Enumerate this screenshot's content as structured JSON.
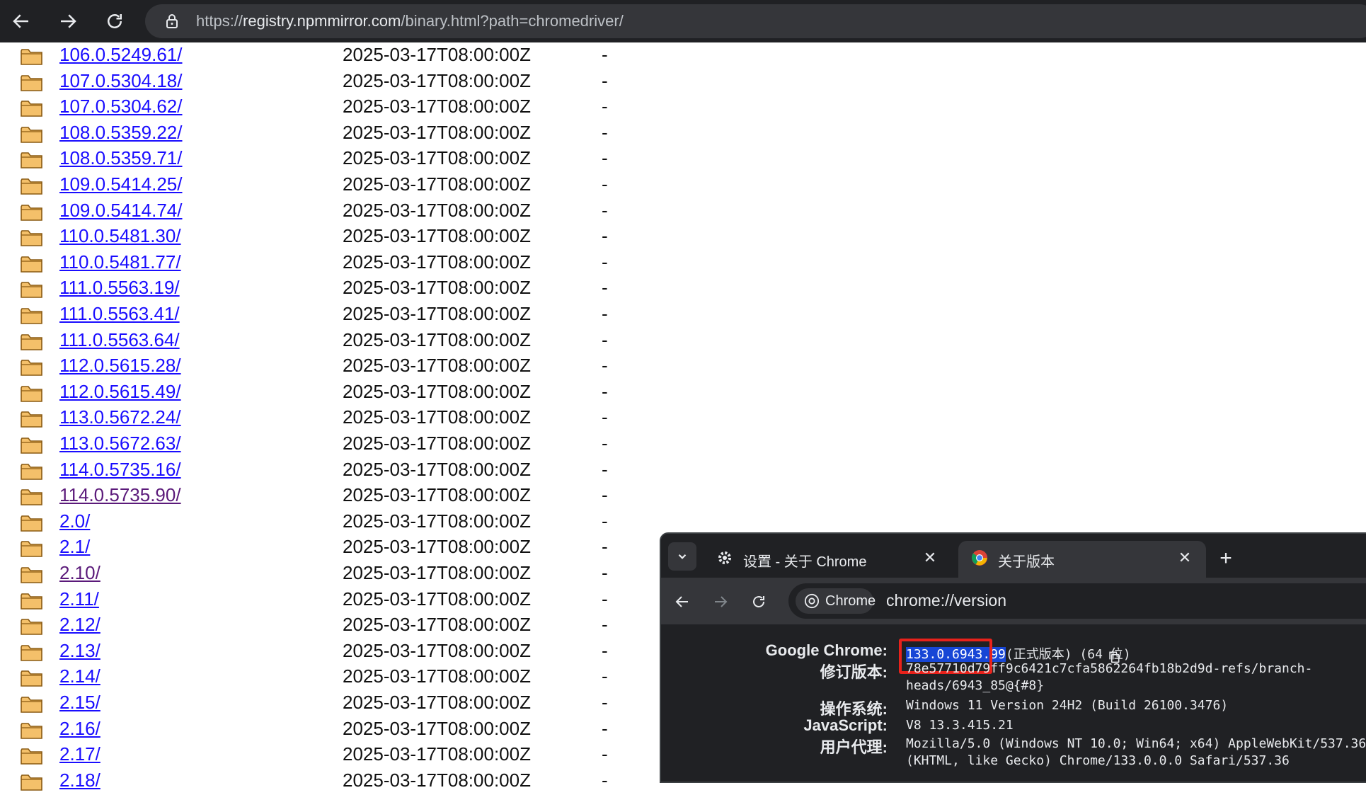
{
  "browser": {
    "url_scheme": "https://",
    "url_host": "registry.npmmirror.com",
    "url_path": "/binary.html?path=chromedriver/"
  },
  "listing": [
    {
      "name": "106.0.5249.61/",
      "date": "2025-03-17T08:00:00Z",
      "size": "-",
      "visited": false
    },
    {
      "name": "107.0.5304.18/",
      "date": "2025-03-17T08:00:00Z",
      "size": "-",
      "visited": false
    },
    {
      "name": "107.0.5304.62/",
      "date": "2025-03-17T08:00:00Z",
      "size": "-",
      "visited": false
    },
    {
      "name": "108.0.5359.22/",
      "date": "2025-03-17T08:00:00Z",
      "size": "-",
      "visited": false
    },
    {
      "name": "108.0.5359.71/",
      "date": "2025-03-17T08:00:00Z",
      "size": "-",
      "visited": false
    },
    {
      "name": "109.0.5414.25/",
      "date": "2025-03-17T08:00:00Z",
      "size": "-",
      "visited": false
    },
    {
      "name": "109.0.5414.74/",
      "date": "2025-03-17T08:00:00Z",
      "size": "-",
      "visited": false
    },
    {
      "name": "110.0.5481.30/",
      "date": "2025-03-17T08:00:00Z",
      "size": "-",
      "visited": false
    },
    {
      "name": "110.0.5481.77/",
      "date": "2025-03-17T08:00:00Z",
      "size": "-",
      "visited": false
    },
    {
      "name": "111.0.5563.19/",
      "date": "2025-03-17T08:00:00Z",
      "size": "-",
      "visited": false
    },
    {
      "name": "111.0.5563.41/",
      "date": "2025-03-17T08:00:00Z",
      "size": "-",
      "visited": false
    },
    {
      "name": "111.0.5563.64/",
      "date": "2025-03-17T08:00:00Z",
      "size": "-",
      "visited": false
    },
    {
      "name": "112.0.5615.28/",
      "date": "2025-03-17T08:00:00Z",
      "size": "-",
      "visited": false
    },
    {
      "name": "112.0.5615.49/",
      "date": "2025-03-17T08:00:00Z",
      "size": "-",
      "visited": false
    },
    {
      "name": "113.0.5672.24/",
      "date": "2025-03-17T08:00:00Z",
      "size": "-",
      "visited": false
    },
    {
      "name": "113.0.5672.63/",
      "date": "2025-03-17T08:00:00Z",
      "size": "-",
      "visited": false
    },
    {
      "name": "114.0.5735.16/",
      "date": "2025-03-17T08:00:00Z",
      "size": "-",
      "visited": false
    },
    {
      "name": "114.0.5735.90/",
      "date": "2025-03-17T08:00:00Z",
      "size": "-",
      "visited": true
    },
    {
      "name": "2.0/",
      "date": "2025-03-17T08:00:00Z",
      "size": "-",
      "visited": false
    },
    {
      "name": "2.1/",
      "date": "2025-03-17T08:00:00Z",
      "size": "-",
      "visited": false
    },
    {
      "name": "2.10/",
      "date": "2025-03-17T08:00:00Z",
      "size": "-",
      "visited": true
    },
    {
      "name": "2.11/",
      "date": "2025-03-17T08:00:00Z",
      "size": "-",
      "visited": false
    },
    {
      "name": "2.12/",
      "date": "2025-03-17T08:00:00Z",
      "size": "-",
      "visited": false
    },
    {
      "name": "2.13/",
      "date": "2025-03-17T08:00:00Z",
      "size": "-",
      "visited": false
    },
    {
      "name": "2.14/",
      "date": "2025-03-17T08:00:00Z",
      "size": "-",
      "visited": false
    },
    {
      "name": "2.15/",
      "date": "2025-03-17T08:00:00Z",
      "size": "-",
      "visited": false
    },
    {
      "name": "2.16/",
      "date": "2025-03-17T08:00:00Z",
      "size": "-",
      "visited": false
    },
    {
      "name": "2.17/",
      "date": "2025-03-17T08:00:00Z",
      "size": "-",
      "visited": false
    },
    {
      "name": "2.18/",
      "date": "2025-03-17T08:00:00Z",
      "size": "-",
      "visited": false
    }
  ],
  "overlay": {
    "tabs": [
      {
        "title": "设置 - 关于 Chrome",
        "icon": "gear-icon"
      },
      {
        "title": "关于版本",
        "icon": "chrome-logo-icon"
      }
    ],
    "chip_label": "Chrome",
    "url": "chrome://version",
    "info": {
      "chrome_label": "Google Chrome:",
      "chrome_version": "133.0.6943.99",
      "chrome_suffix": "(正式版本) (64 位)",
      "revision_label": "修订版本:",
      "revision_line1": "78e57710d79ff9c6421c7cfa5862264fb18b2d9d-refs/branch-",
      "revision_line2": "heads/6943_85@{#8}",
      "os_label": "操作系统:",
      "os_value": "Windows 11 Version 24H2 (Build 26100.3476)",
      "js_label": "JavaScript:",
      "js_value": "V8 13.3.415.21",
      "ua_label": "用户代理:",
      "ua_line1": "Mozilla/5.0 (Windows NT 10.0; Win64; x64) AppleWebKit/537.36",
      "ua_line2": "(KHTML, like Gecko) Chrome/133.0.0.0 Safari/537.36"
    }
  },
  "colors": {
    "link": "#1a0dff",
    "visited": "#5b1a7a",
    "highlight": "#e8221b"
  }
}
